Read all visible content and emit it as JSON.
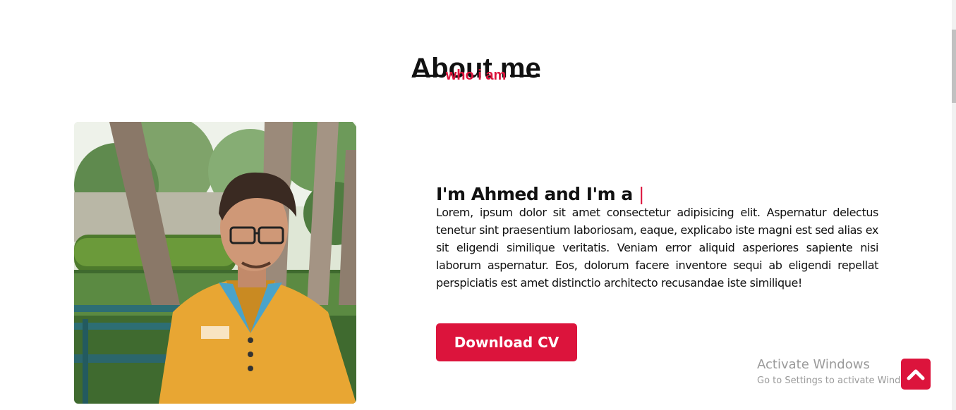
{
  "section": {
    "title": "About me",
    "subtitle": "who i am"
  },
  "about": {
    "heading": "I'm Ahmed and I'm a",
    "cursor": "|",
    "paragraph": "Lorem, ipsum dolor sit amet consectetur adipisicing elit. Aspernatur delectus tenetur sint praesentium laboriosam, eaque, explicabo iste magni est sed alias ex sit eligendi similique veritatis. Veniam error aliquid asperiores sapiente nisi laborum aspernatur. Eos, dolorum facere inventore sequi ab eligendi repellat perspiciatis est amet distinctio architecto recusandae iste similique!",
    "button_label": "Download CV",
    "photo_icon": "profile-photo"
  },
  "watermark": {
    "line1": "Activate Windows",
    "line2": "Go to Settings to activate Windows."
  },
  "scroll_top": {
    "icon": "chevron-up-icon"
  },
  "colors": {
    "accent": "#dc143c",
    "text": "#111111",
    "background": "#ffffff"
  }
}
